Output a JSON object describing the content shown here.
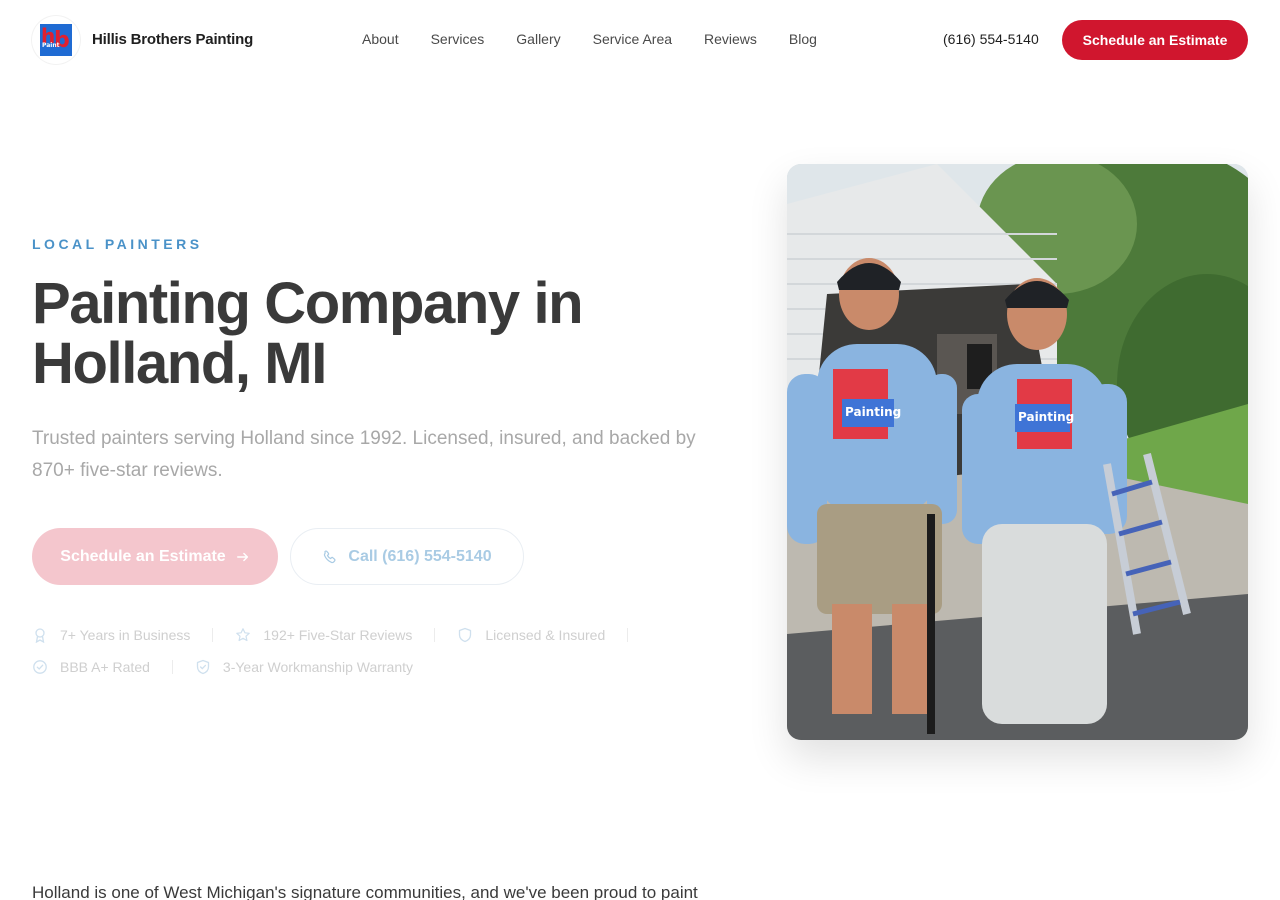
{
  "header": {
    "brand": "Hillis Brothers Painting",
    "nav": [
      "About",
      "Services",
      "Gallery",
      "Service Area",
      "Reviews",
      "Blog"
    ],
    "phone": "(616) 554-5140",
    "cta": "Schedule an Estimate"
  },
  "hero": {
    "eyebrow": "LOCAL PAINTERS",
    "title_line1": "Painting Company in",
    "title_line2": "Holland, MI",
    "lead": "Trusted painters serving Holland since 1992. Licensed, insured, and backed by 870+ five-star reviews.",
    "primary_cta": "Schedule an Estimate",
    "secondary_cta": "Call (616) 554-5140",
    "badges": [
      {
        "icon": "award-icon",
        "label": "7+ Years in Business"
      },
      {
        "icon": "star-icon",
        "label": "192+ Five-Star Reviews"
      },
      {
        "icon": "shield-icon",
        "label": "Licensed & Insured"
      },
      {
        "icon": "check-circle-icon",
        "label": "BBB A+ Rated"
      },
      {
        "icon": "shield-check-icon",
        "label": "3-Year Workmanship Warranty"
      }
    ],
    "photo_shirt_text": "Painting"
  },
  "intro": {
    "text": "Holland is one of West Michigan's signature communities, and we've been proud to paint"
  },
  "colors": {
    "accent_red": "#d0162e",
    "eyebrow_blue": "#4a92c8",
    "heading": "#3a3a3a"
  }
}
